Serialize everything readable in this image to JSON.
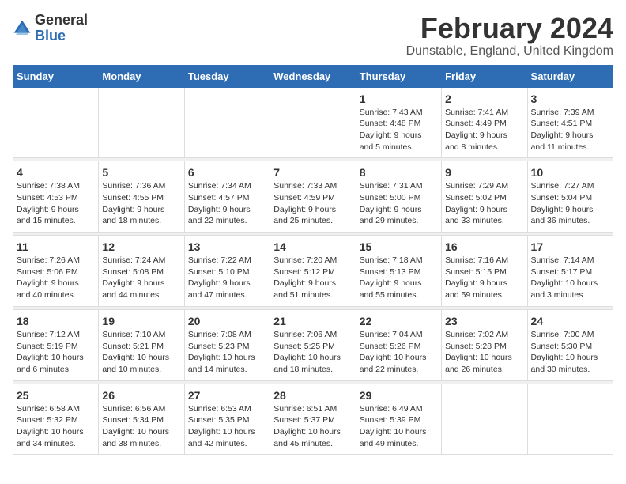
{
  "logo": {
    "general": "General",
    "blue": "Blue"
  },
  "title": "February 2024",
  "location": "Dunstable, England, United Kingdom",
  "days_of_week": [
    "Sunday",
    "Monday",
    "Tuesday",
    "Wednesday",
    "Thursday",
    "Friday",
    "Saturday"
  ],
  "weeks": [
    [
      {
        "day": "",
        "info": ""
      },
      {
        "day": "",
        "info": ""
      },
      {
        "day": "",
        "info": ""
      },
      {
        "day": "",
        "info": ""
      },
      {
        "day": "1",
        "info": "Sunrise: 7:43 AM\nSunset: 4:48 PM\nDaylight: 9 hours\nand 5 minutes."
      },
      {
        "day": "2",
        "info": "Sunrise: 7:41 AM\nSunset: 4:49 PM\nDaylight: 9 hours\nand 8 minutes."
      },
      {
        "day": "3",
        "info": "Sunrise: 7:39 AM\nSunset: 4:51 PM\nDaylight: 9 hours\nand 11 minutes."
      }
    ],
    [
      {
        "day": "4",
        "info": "Sunrise: 7:38 AM\nSunset: 4:53 PM\nDaylight: 9 hours\nand 15 minutes."
      },
      {
        "day": "5",
        "info": "Sunrise: 7:36 AM\nSunset: 4:55 PM\nDaylight: 9 hours\nand 18 minutes."
      },
      {
        "day": "6",
        "info": "Sunrise: 7:34 AM\nSunset: 4:57 PM\nDaylight: 9 hours\nand 22 minutes."
      },
      {
        "day": "7",
        "info": "Sunrise: 7:33 AM\nSunset: 4:59 PM\nDaylight: 9 hours\nand 25 minutes."
      },
      {
        "day": "8",
        "info": "Sunrise: 7:31 AM\nSunset: 5:00 PM\nDaylight: 9 hours\nand 29 minutes."
      },
      {
        "day": "9",
        "info": "Sunrise: 7:29 AM\nSunset: 5:02 PM\nDaylight: 9 hours\nand 33 minutes."
      },
      {
        "day": "10",
        "info": "Sunrise: 7:27 AM\nSunset: 5:04 PM\nDaylight: 9 hours\nand 36 minutes."
      }
    ],
    [
      {
        "day": "11",
        "info": "Sunrise: 7:26 AM\nSunset: 5:06 PM\nDaylight: 9 hours\nand 40 minutes."
      },
      {
        "day": "12",
        "info": "Sunrise: 7:24 AM\nSunset: 5:08 PM\nDaylight: 9 hours\nand 44 minutes."
      },
      {
        "day": "13",
        "info": "Sunrise: 7:22 AM\nSunset: 5:10 PM\nDaylight: 9 hours\nand 47 minutes."
      },
      {
        "day": "14",
        "info": "Sunrise: 7:20 AM\nSunset: 5:12 PM\nDaylight: 9 hours\nand 51 minutes."
      },
      {
        "day": "15",
        "info": "Sunrise: 7:18 AM\nSunset: 5:13 PM\nDaylight: 9 hours\nand 55 minutes."
      },
      {
        "day": "16",
        "info": "Sunrise: 7:16 AM\nSunset: 5:15 PM\nDaylight: 9 hours\nand 59 minutes."
      },
      {
        "day": "17",
        "info": "Sunrise: 7:14 AM\nSunset: 5:17 PM\nDaylight: 10 hours\nand 3 minutes."
      }
    ],
    [
      {
        "day": "18",
        "info": "Sunrise: 7:12 AM\nSunset: 5:19 PM\nDaylight: 10 hours\nand 6 minutes."
      },
      {
        "day": "19",
        "info": "Sunrise: 7:10 AM\nSunset: 5:21 PM\nDaylight: 10 hours\nand 10 minutes."
      },
      {
        "day": "20",
        "info": "Sunrise: 7:08 AM\nSunset: 5:23 PM\nDaylight: 10 hours\nand 14 minutes."
      },
      {
        "day": "21",
        "info": "Sunrise: 7:06 AM\nSunset: 5:25 PM\nDaylight: 10 hours\nand 18 minutes."
      },
      {
        "day": "22",
        "info": "Sunrise: 7:04 AM\nSunset: 5:26 PM\nDaylight: 10 hours\nand 22 minutes."
      },
      {
        "day": "23",
        "info": "Sunrise: 7:02 AM\nSunset: 5:28 PM\nDaylight: 10 hours\nand 26 minutes."
      },
      {
        "day": "24",
        "info": "Sunrise: 7:00 AM\nSunset: 5:30 PM\nDaylight: 10 hours\nand 30 minutes."
      }
    ],
    [
      {
        "day": "25",
        "info": "Sunrise: 6:58 AM\nSunset: 5:32 PM\nDaylight: 10 hours\nand 34 minutes."
      },
      {
        "day": "26",
        "info": "Sunrise: 6:56 AM\nSunset: 5:34 PM\nDaylight: 10 hours\nand 38 minutes."
      },
      {
        "day": "27",
        "info": "Sunrise: 6:53 AM\nSunset: 5:35 PM\nDaylight: 10 hours\nand 42 minutes."
      },
      {
        "day": "28",
        "info": "Sunrise: 6:51 AM\nSunset: 5:37 PM\nDaylight: 10 hours\nand 45 minutes."
      },
      {
        "day": "29",
        "info": "Sunrise: 6:49 AM\nSunset: 5:39 PM\nDaylight: 10 hours\nand 49 minutes."
      },
      {
        "day": "",
        "info": ""
      },
      {
        "day": "",
        "info": ""
      }
    ]
  ]
}
